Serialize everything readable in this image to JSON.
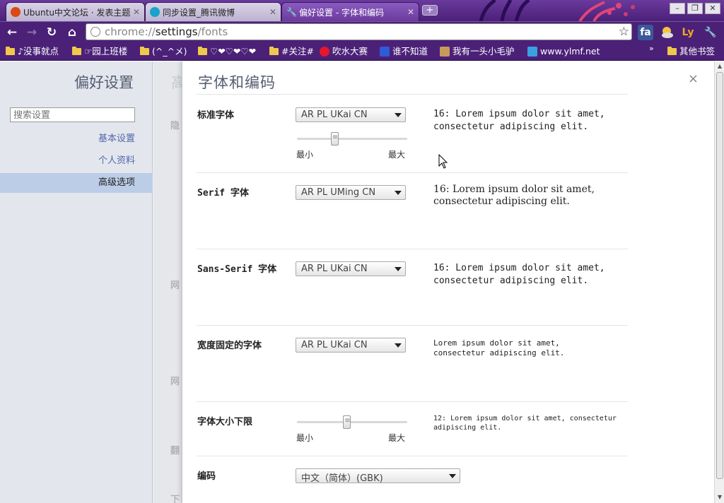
{
  "browser": {
    "tabs": [
      {
        "title": "Ubuntu中文论坛 · 发表主题",
        "icon": "ubuntu-icon",
        "active": false
      },
      {
        "title": "同步设置_腾讯微博",
        "icon": "qq-weibo-icon",
        "active": false
      },
      {
        "title": "偏好设置 - 字体和编码",
        "icon": "wrench-icon",
        "active": true
      }
    ],
    "new_tab_label": "+",
    "window_controls": {
      "minimize": "–",
      "maximize": "❐",
      "close": "✕"
    },
    "address": {
      "scheme": "chrome://",
      "host": "settings",
      "path": "/fonts"
    },
    "extensions": [
      "fa",
      "Ly"
    ],
    "bookmarks": [
      {
        "label": "♪没事就点",
        "type": "folder"
      },
      {
        "label": "☞园上班楼",
        "type": "folder"
      },
      {
        "label": "(^_^メ)",
        "type": "folder"
      },
      {
        "label": "♡❤♡❤♡❤",
        "type": "folder"
      },
      {
        "label": "#关注#",
        "type": "folder"
      },
      {
        "label": "吹水大赛",
        "type": "site"
      },
      {
        "label": "谁不知道",
        "type": "site"
      },
      {
        "label": "我有一头小毛驴",
        "type": "site"
      },
      {
        "label": "www.ylmf.net",
        "type": "site"
      },
      {
        "label": "其他书签",
        "type": "folder"
      }
    ],
    "bookmarks_overflow": "»"
  },
  "settings_nav": {
    "title": "偏好设置",
    "search_placeholder": "搜索设置",
    "items": [
      {
        "label": "基本设置",
        "selected": false
      },
      {
        "label": "个人资料",
        "selected": false
      },
      {
        "label": "高级选项",
        "selected": true
      }
    ]
  },
  "background_page": {
    "title_fragment": "高",
    "labels": [
      "隐",
      "网",
      "网",
      "翻",
      "下"
    ]
  },
  "dialog": {
    "title": "字体和编码",
    "close_label": "×",
    "rows": [
      {
        "label": "标准字体",
        "font": "AR PL UKai CN",
        "sample": "16: Lorem ipsum dolor sit amet, consectetur adipiscing elit.",
        "slider": {
          "min_label": "最小",
          "max_label": "最大",
          "position": 0.33
        }
      },
      {
        "label": "Serif 字体",
        "font": "AR PL UMing CN",
        "sample": "16: Lorem ipsum dolor sit amet, consectetur adipiscing elit."
      },
      {
        "label": "Sans-Serif 字体",
        "font": "AR PL UKai CN",
        "sample": "16: Lorem ipsum dolor sit amet, consectetur adipiscing elit."
      },
      {
        "label": "宽度固定的字体",
        "font": "AR PL UKai CN",
        "sample": "Lorem ipsum dolor sit amet, consectetur adipiscing elit."
      },
      {
        "label": "字体大小下限",
        "sample": "12: Lorem ipsum dolor sit amet, consectetur adipiscing elit.",
        "slider": {
          "min_label": "最小",
          "max_label": "最大",
          "position": 0.45
        }
      },
      {
        "label": "编码",
        "encoding": "中文（简体）(GBK)"
      }
    ]
  },
  "colors": {
    "chrome_purple": "#4b2178",
    "link_blue": "#4e6aa8",
    "nav_selected": "#bccde8"
  }
}
